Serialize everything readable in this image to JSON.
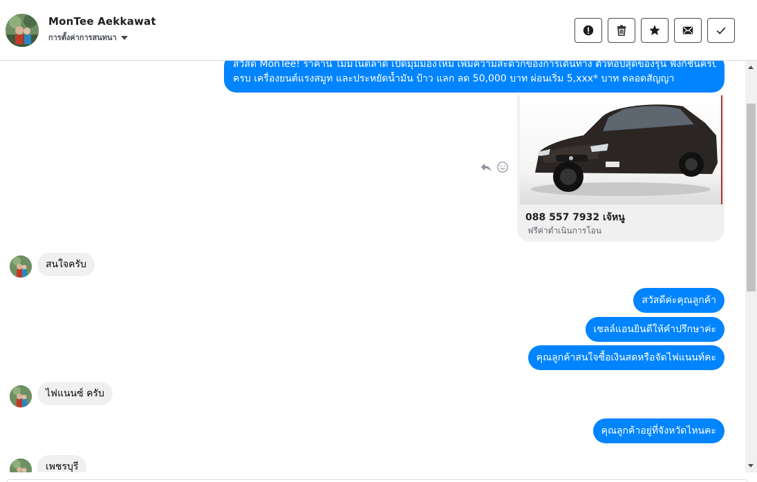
{
  "header": {
    "contact_name": "MonTee Aekkawat",
    "settings_label": "การตั้งค่าการสนทนา",
    "actions": [
      {
        "name": "mark-spam",
        "icon": "exclamation-circle-icon"
      },
      {
        "name": "delete",
        "icon": "trash-icon"
      },
      {
        "name": "star",
        "icon": "star-icon"
      },
      {
        "name": "mark-unread",
        "icon": "envelope-icon"
      },
      {
        "name": "mark-done",
        "icon": "checkmark-icon"
      }
    ]
  },
  "thread": {
    "first_message": {
      "line1": "สวัสดี MonTee! ราคานี้ ไม่มีในตลาด เปิดมุมมองใหม่ เพิ่มความสะดวกของการเดินทาง ตัวท็อปสุดของรุ่น ฟังก์ชั่นครบ",
      "line2": "ครบ เครื่องยนต์แรงสมูท และประหยัดน้ำมัน ป้าว แลก ลด 50,000 บาท ผ่อนเริ่ม 5,xxx* บาท ตลอดสัญญา"
    },
    "card": {
      "title": "088 557 7932 เจ้หนู",
      "subtitle": "ฟรีค่าดำเนินการโอน",
      "image_icon": "car-photo-icon"
    },
    "hover_tools": {
      "reply_icon": "reply-icon",
      "react_icon": "smiley-icon"
    },
    "messages": [
      {
        "from": "customer",
        "text": "สนใจครับ"
      },
      {
        "from": "page",
        "text": "สวัสดีค่ะคุณลูกค้า"
      },
      {
        "from": "page",
        "text": "เซลล์แอนยินดีให้คำปรึกษาค่ะ"
      },
      {
        "from": "page",
        "text": "คุณลูกค้าสนใจซื้อเงินสดหรือจัดไฟแนนท์คะ"
      },
      {
        "from": "customer",
        "text": "ไฟแนนซ์ ครับ"
      },
      {
        "from": "page",
        "text": "คุณลูกค้าอยู่ที่จังหวัดไหนคะ"
      },
      {
        "from": "customer",
        "text": "เพชรบุรี"
      }
    ]
  },
  "colors": {
    "outgoing_bubble": "#0084ff",
    "incoming_bubble": "#f0f0f0",
    "header_border": "#dadde1"
  }
}
